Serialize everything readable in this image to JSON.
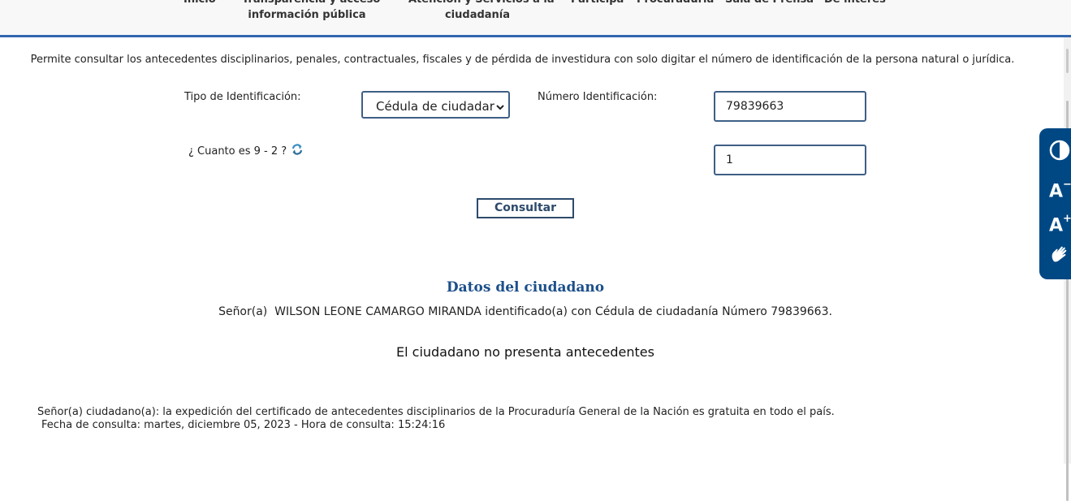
{
  "nav": {
    "items": [
      {
        "line1": "Inicio",
        "line2": ""
      },
      {
        "line1": "Transparencia y acceso",
        "line2": "información pública"
      },
      {
        "line1": "Atención y Servicios a la",
        "line2": "ciudadanía"
      },
      {
        "line1": "Participa",
        "line2": ""
      },
      {
        "line1": "Procuraduría",
        "line2": ""
      },
      {
        "line1": "Sala de Prensa",
        "line2": ""
      },
      {
        "line1": "De interés",
        "line2": ""
      }
    ]
  },
  "intro_text": "Permite consultar los antecedentes disciplinarios, penales, contractuales, fiscales y de pérdida de investidura con solo digitar el número de identificación de la persona natural o jurídica.",
  "form": {
    "id_type_label": "Tipo de Identificación:",
    "id_type_value": "Cédula de ciudadar",
    "id_number_label": "Número Identificación:",
    "id_number_value": "79839663",
    "captcha_label": "¿ Cuanto es 9 - 2 ?",
    "captcha_answer": "1",
    "submit_label": "Consultar"
  },
  "result": {
    "title": "Datos del ciudadano",
    "citizen_text": "Señor(a)  WILSON LEONE CAMARGO MIRANDA identificado(a) con Cédula de ciudadanía Número 79839663.",
    "status": "El ciudadano no presenta antecedentes"
  },
  "footer": {
    "note": "Señor(a) ciudadano(a): la expedición del certificado de antecedentes disciplinarios de la Procuraduría General de la Nación es gratuita en todo el país.",
    "timestamp": "Fecha de consulta: martes, diciembre 05, 2023 - Hora de consulta: 15:24:16"
  },
  "accessibility": {
    "contrast_icon": "contrast-icon",
    "decrease_font": "A",
    "increase_font": "A",
    "sign_language_icon": "hand-icon"
  },
  "colors": {
    "nav_border": "#3366b0",
    "a11y_bar": "#004884",
    "section_title": "#1c4f8a",
    "input_border": "#3e5f86"
  }
}
